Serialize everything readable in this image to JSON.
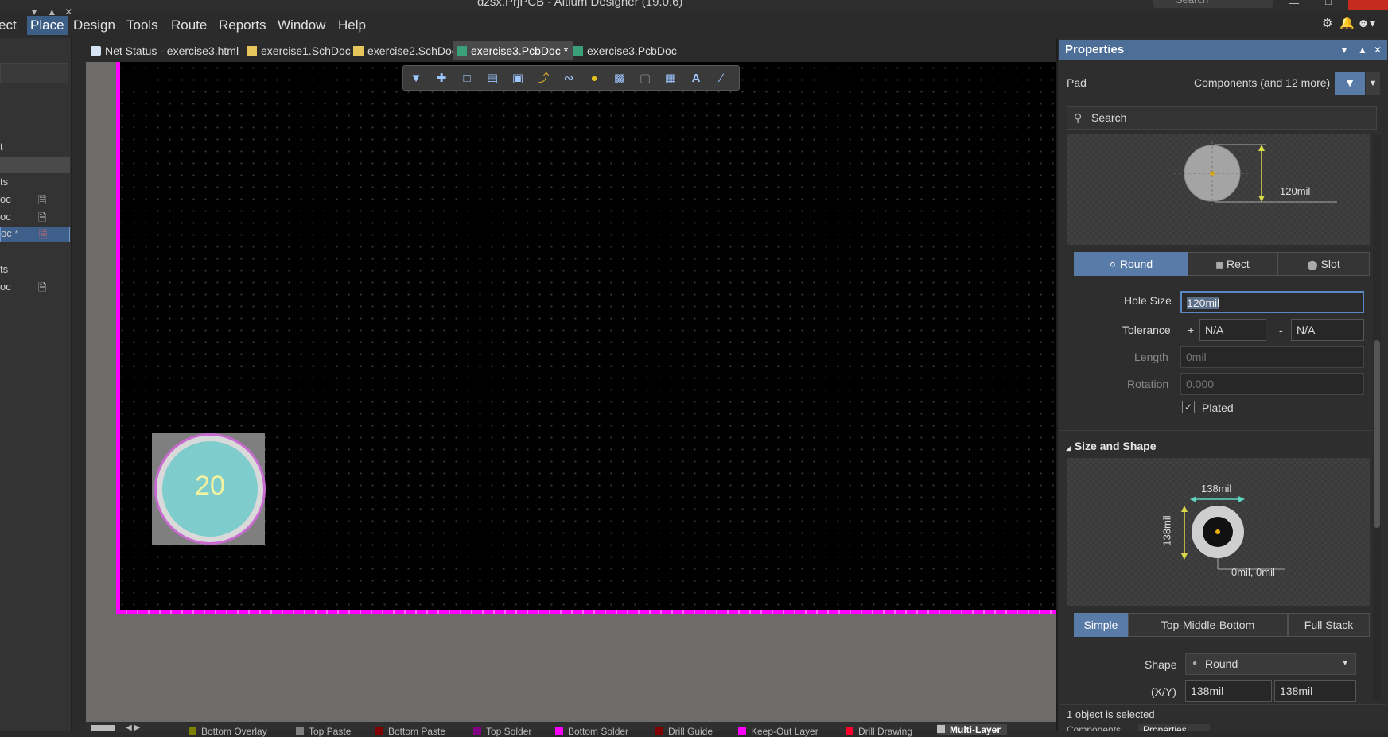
{
  "window": {
    "title": "dzsx.PrjPCB - Altium Designer (19.0.6)",
    "search_placeholder": "Search"
  },
  "menu": [
    "ect",
    "Place",
    "Design",
    "Tools",
    "Route",
    "Reports",
    "Window",
    "Help"
  ],
  "left_panel": {
    "rows": [
      {
        "text": "t"
      },
      {
        "text": "ts"
      },
      {
        "text": "oc"
      },
      {
        "text": "oc"
      },
      {
        "text": "oc *"
      },
      {
        "text": "ts"
      },
      {
        "text": "oc"
      }
    ]
  },
  "tabs": [
    {
      "label": "Net Status - exercise3.html",
      "type": "html"
    },
    {
      "label": "exercise1.SchDoc",
      "type": "sch"
    },
    {
      "label": "exercise2.SchDoc",
      "type": "sch"
    },
    {
      "label": "exercise3.PcbDoc *",
      "type": "pcb",
      "active": true
    },
    {
      "label": "exercise3.PcbDoc",
      "type": "pcb"
    }
  ],
  "canvas": {
    "pad_label": "20"
  },
  "layers": [
    {
      "label": "Bottom Overlay",
      "color": "#808000"
    },
    {
      "label": "Top Paste",
      "color": "#808080"
    },
    {
      "label": "Bottom Paste",
      "color": "#800000"
    },
    {
      "label": "Top Solder",
      "color": "#800080"
    },
    {
      "label": "Bottom Solder",
      "color": "#ff00ff"
    },
    {
      "label": "Drill Guide",
      "color": "#800000"
    },
    {
      "label": "Keep-Out Layer",
      "color": "#ff00ff"
    },
    {
      "label": "Drill Drawing",
      "color": "#ff002a"
    },
    {
      "label": "Multi-Layer",
      "color": "#c0c0c0"
    }
  ],
  "properties": {
    "title": "Properties",
    "object_type": "Pad",
    "filter_text": "Components (and 12 more)",
    "search_placeholder": "Search",
    "hole_preview_dim": "120mil",
    "hole_shapes": [
      {
        "label": "Round",
        "on": true
      },
      {
        "label": "Rect",
        "on": false
      },
      {
        "label": "Slot",
        "on": false
      }
    ],
    "hole_size": {
      "label": "Hole Size",
      "value": "120mil"
    },
    "tolerance": {
      "label": "Tolerance",
      "plus": "+",
      "plus_value": "N/A",
      "minus": "-",
      "minus_value": "N/A"
    },
    "length": {
      "label": "Length",
      "value": "0mil"
    },
    "rotation": {
      "label": "Rotation",
      "value": "0.000"
    },
    "plated": {
      "label": "Plated",
      "checked": true
    },
    "size_shape_header": "Size and Shape",
    "size_preview": {
      "width": "138mil",
      "height": "138mil",
      "offset": "0mil, 0mil"
    },
    "stack_modes": [
      {
        "label": "Simple",
        "on": true
      },
      {
        "label": "Top-Middle-Bottom",
        "on": false
      },
      {
        "label": "Full Stack",
        "on": false
      }
    ],
    "shape": {
      "label": "Shape",
      "value": "Round"
    },
    "xy": {
      "label": "(X/Y)",
      "x": "138mil",
      "y": "138mil"
    },
    "status": "1 object is selected",
    "bottom_tabs": [
      "Components",
      "Properties"
    ]
  }
}
